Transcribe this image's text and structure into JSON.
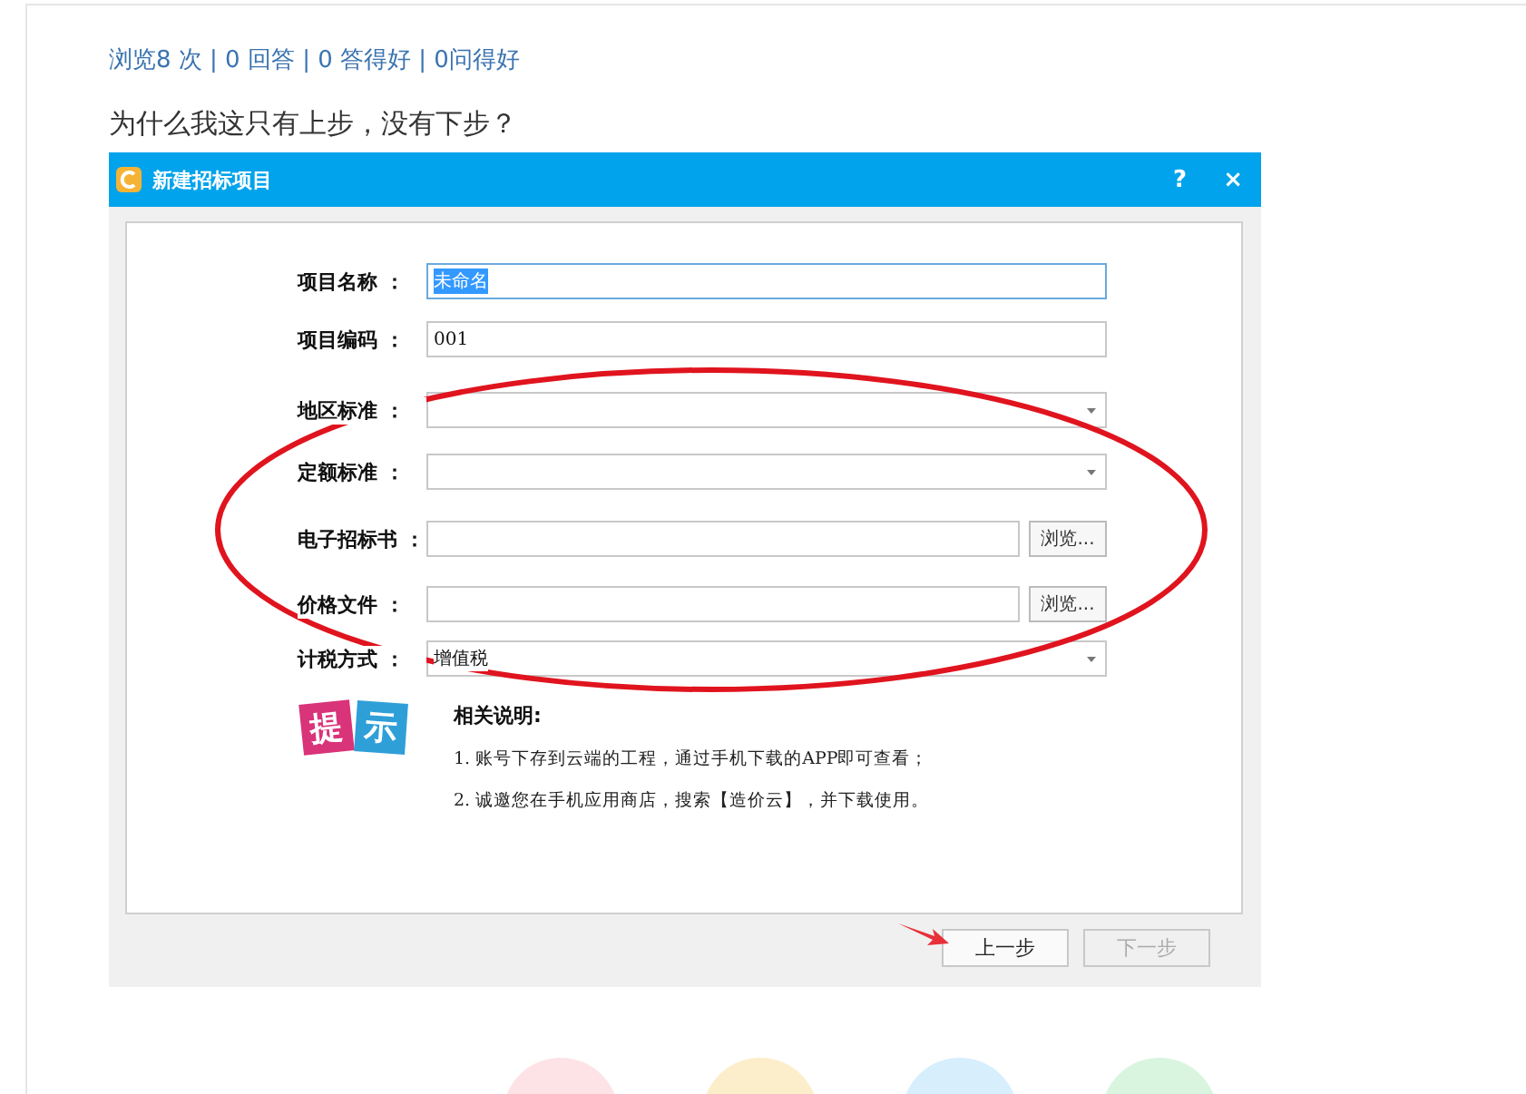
{
  "stats": "浏览8 次 | 0 回答 | 0 答得好 | 0问得好",
  "question": "为什么我这只有上步，没有下步？",
  "dialog": {
    "title": "新建招标项目",
    "help": "?",
    "close": "×",
    "fields": [
      {
        "kind": "text",
        "label": "项目名称 ：",
        "value": "未命名",
        "highlighted": true
      },
      {
        "kind": "text",
        "label": "项目编码 ：",
        "value": "001",
        "highlighted": false
      },
      {
        "kind": "select",
        "label": "地区标准 ："
      },
      {
        "kind": "select",
        "label": "定额标准 ："
      },
      {
        "kind": "file",
        "label": "电子招标书 ：",
        "button": "浏览..."
      },
      {
        "kind": "file",
        "label": "价格文件 ：",
        "button": "浏览..."
      },
      {
        "kind": "select",
        "label": "计税方式 ：",
        "value": "增值税"
      }
    ],
    "tip": {
      "badge": [
        "提",
        "示"
      ],
      "title": "相关说明:",
      "notes": [
        "1. 账号下存到云端的工程，通过手机下载的APP即可查看；",
        "2. 诚邀您在手机应用商店，搜索【造价云】，并下载使用。"
      ]
    },
    "buttons": [
      {
        "label": "上一步",
        "disabled": false
      },
      {
        "label": "下一步",
        "disabled": true
      }
    ]
  },
  "bottom_actions": [
    {
      "color": "#fde3e6"
    },
    {
      "color": "#fdeecb"
    },
    {
      "color": "#d7eefc"
    },
    {
      "color": "#d9f5df"
    }
  ]
}
